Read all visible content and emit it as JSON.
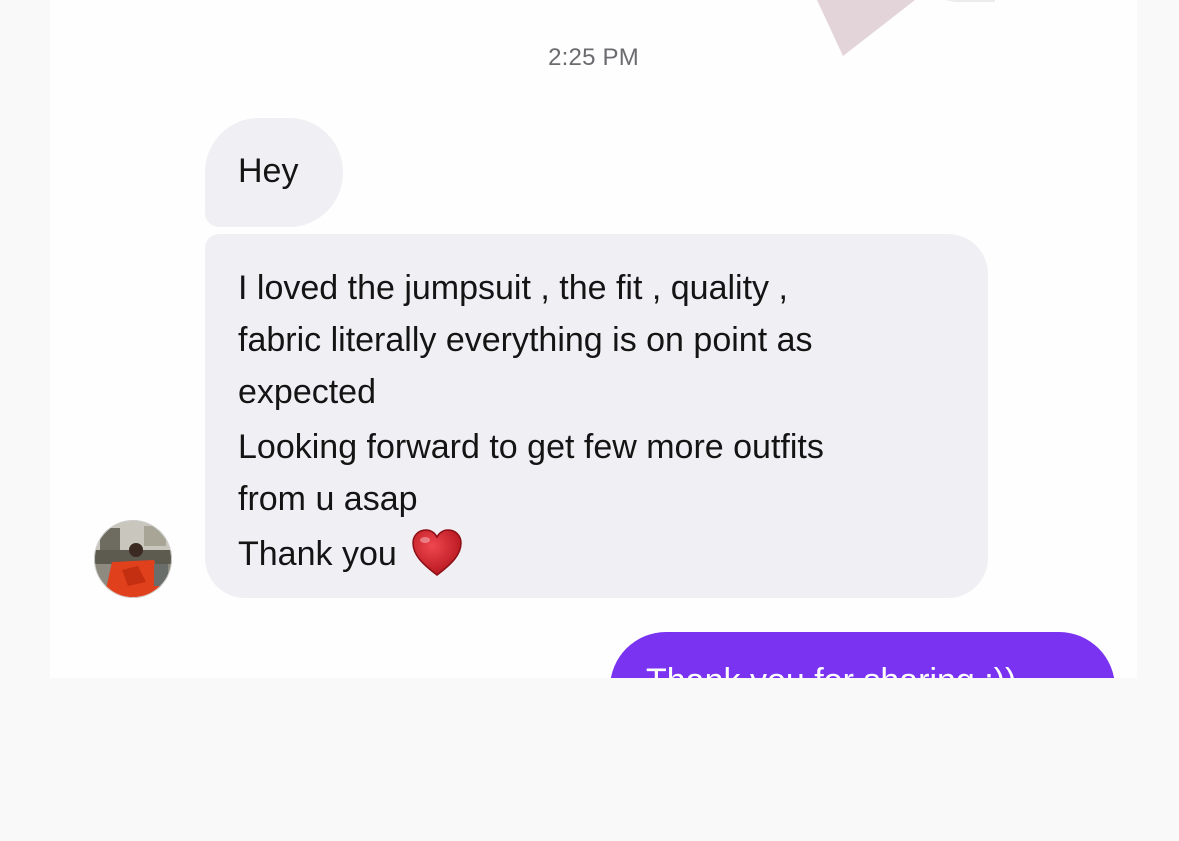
{
  "conversation": {
    "timestamp": "2:25 PM",
    "incoming": {
      "greeting": "Hey",
      "message_lines": [
        "I loved the jumpsuit , the fit , quality ,",
        "fabric literally everything is on point as",
        "expected",
        "Looking forward to get few more outfits",
        "from u asap",
        "Thank you"
      ],
      "emoji": "heart-emoji",
      "avatar_icon": "profile-photo-avatar"
    },
    "outgoing": {
      "message": "Thank you for sharing :))"
    }
  },
  "colors": {
    "incoming_bubble": "#efeff4",
    "outgoing_bubble": "#7a33f0",
    "heart": "#d9202a",
    "timestamp_text": "#6b6b70"
  }
}
